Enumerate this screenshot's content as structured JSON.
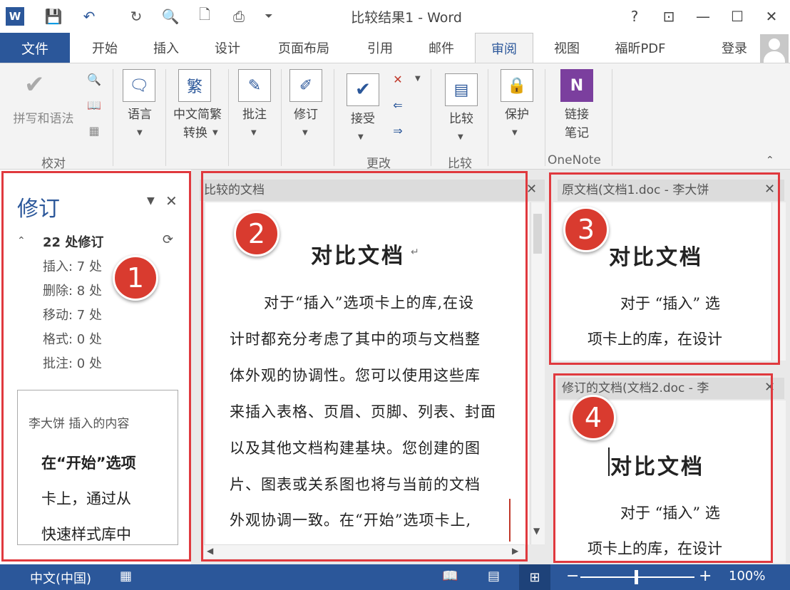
{
  "window": {
    "title": "比较结果1 - Word",
    "help": "?",
    "qat_icons": [
      "word-logo-icon",
      "save-icon",
      "undo-icon",
      "redo-icon",
      "print-preview-icon",
      "new-document-icon",
      "print-icon",
      "customize-icon"
    ]
  },
  "tabs": {
    "file": "文件",
    "items": [
      "开始",
      "插入",
      "设计",
      "页面布局",
      "引用",
      "邮件",
      "审阅",
      "视图",
      "福昕PDF"
    ],
    "active": "审阅",
    "login": "登录"
  },
  "ribbon": {
    "proofing": {
      "spelling": "拼写和语法",
      "group": "校对"
    },
    "language": {
      "label": "语言"
    },
    "chinese": {
      "label1": "中文简繁",
      "label2": "转换"
    },
    "comments": {
      "label": "批注"
    },
    "tracking": {
      "label": "修订"
    },
    "changes": {
      "accept": "接受",
      "group": "更改"
    },
    "compare": {
      "label": "比较",
      "group": "比较"
    },
    "protect": {
      "label": "保护"
    },
    "onenote": {
      "label1": "链接",
      "label2": "笔记",
      "group": "OneNote"
    }
  },
  "revisions": {
    "title": "修订",
    "count": "22 处修订",
    "insert": "插入: 7 处",
    "delete": "删除: 8 处",
    "move": "移动: 7 处",
    "format": "格式: 0 处",
    "comment": "批注: 0 处",
    "box_author": "李大饼 插入的内容",
    "box_line1": "在“开始”选项",
    "box_line2": "卡上，通过从",
    "box_line3": "快速样式库中"
  },
  "compared": {
    "header": "比较的文档",
    "title": "对比文档",
    "lines": [
      "对于“插入”选项卡上的库,在设",
      "计时都充分考虑了其中的项与文档整",
      "体外观的协调性。您可以使用这些库",
      "来插入表格、页眉、页脚、列表、封面",
      "以及其他文档构建基块。您创建的图",
      "片、图表或关系图也将与当前的文档",
      "外观协调一致。在“开始”选项卡上,"
    ]
  },
  "original": {
    "header": "原文档(文档1.doc - 李大饼",
    "title": "对比文档",
    "line1": "对于 “插入” 选",
    "line2": "项卡上的库，在设计"
  },
  "revised": {
    "header": "修订的文档(文档2.doc - 李",
    "title": "对比文档",
    "line1": "对于 “插入” 选",
    "line2": "项卡上的库，在设计"
  },
  "badges": [
    "1",
    "2",
    "3",
    "4"
  ],
  "statusbar": {
    "language": "中文(中国)",
    "zoom": "100%"
  },
  "colors": {
    "accent": "#2b579a",
    "annotation": "#e0393e",
    "badge": "#d93b2f"
  }
}
